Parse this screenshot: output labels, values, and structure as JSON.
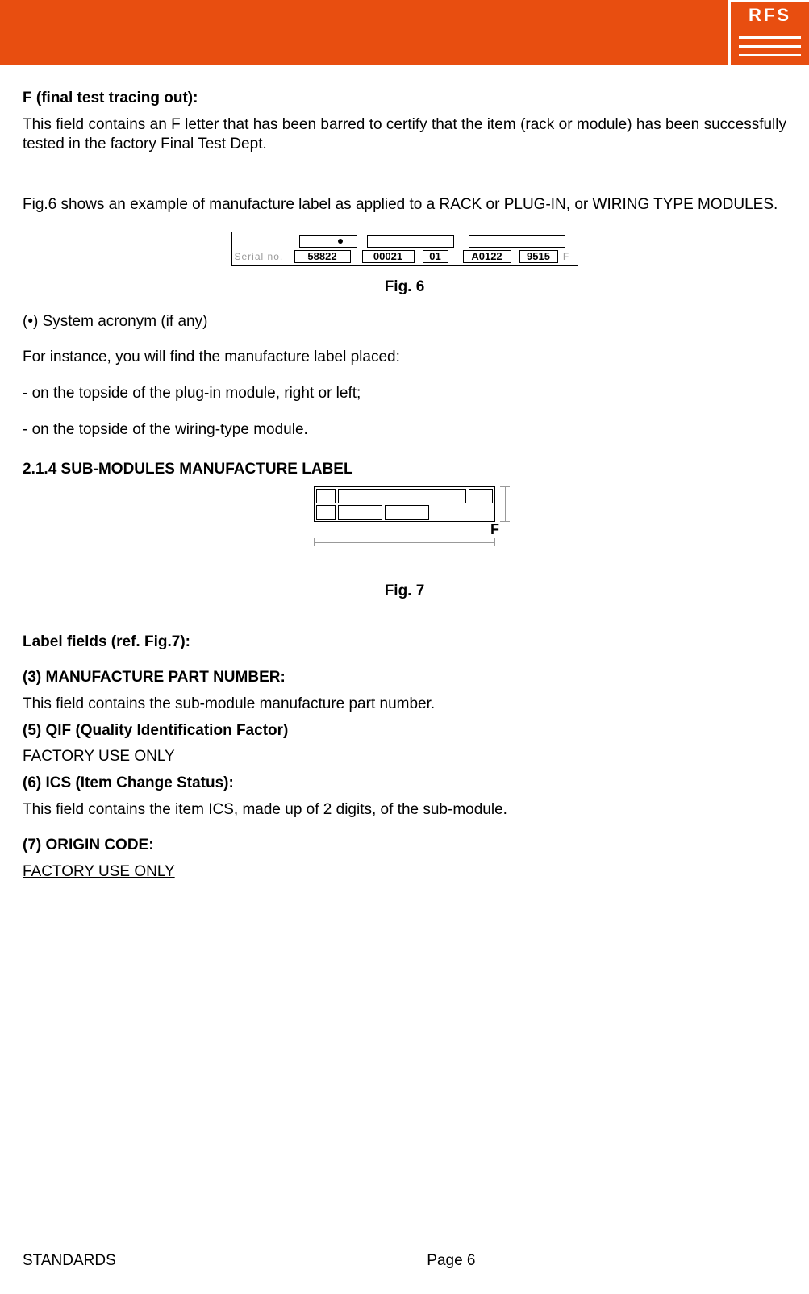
{
  "header": {
    "logo_text": "RFS"
  },
  "body": {
    "f_heading": "F (final test tracing out):",
    "f_text": "This field contains an F letter that has been barred to certify that the item (rack or module) has been successfully tested in the factory Final Test Dept.",
    "fig6_intro": "Fig.6 shows an example of manufacture label as applied to a RACK or PLUG-IN, or WIRING TYPE MODULES.",
    "fig6": {
      "serial_label": "Serial no.",
      "cells": [
        "58822",
        "00021",
        "01",
        "A0122",
        "9515"
      ],
      "tail": "F",
      "caption": "Fig. 6"
    },
    "bullet_sys": "(•) System acronym (if any)",
    "instance": "For instance, you will find the manufacture label placed:",
    "dash1": "- on the topside of the plug-in module, right or left;",
    "dash2": "- on the topside of the wiring-type module.",
    "sec214": "2.1.4 SUB-MODULES MANUFACTURE LABEL",
    "fig7": {
      "F": "F",
      "caption": "Fig. 7"
    },
    "label_fields": "Label fields (ref. Fig.7):",
    "f3_h": "(3) MANUFACTURE PART NUMBER:",
    "f3_t": "This field contains the sub-module manufacture part number.",
    "f5_h": "(5) QIF (Quality Identification Factor)",
    "f5_t": "FACTORY USE ONLY",
    "f6_h": "(6) ICS (Item Change Status):",
    "f6_t": "This field contains the item ICS, made up of 2 digits, of the sub-module.",
    "f7_h": "(7) ORIGIN CODE:",
    "f7_t": "FACTORY USE ONLY"
  },
  "footer": {
    "left": "STANDARDS",
    "center": "Page 6"
  }
}
